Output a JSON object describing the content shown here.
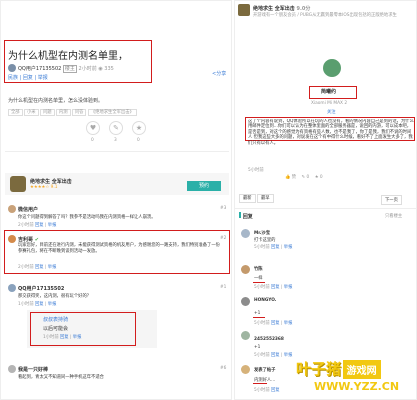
{
  "left": {
    "question_title": "为什么机型在内测名单里，",
    "asker": {
      "name": "QQ用户17135502",
      "badge": "楼主",
      "time": "2小时前",
      "views": "335",
      "links": [
        "民族",
        "回复",
        "举报"
      ],
      "share": "分享"
    },
    "question_body": "为什么机型在内测名单里，怎么没体验到。",
    "tags": [
      "全部",
      "小米",
      "问题",
      "内测",
      "问答",
      "《绝地求生全军出击》"
    ],
    "stat_numbers": [
      "0",
      "3",
      "0"
    ],
    "game_card": {
      "title": "绝地求生 全军出击",
      "rating": "9.1",
      "reserve": "预约"
    },
    "replies": [
      {
        "name": "微信用户",
        "floor": "#3",
        "text": "你这个问题得到解答了吗？我参不是活动吗我在内测资格一样让人崩溃。",
        "time": "2小时前",
        "links": [
          "回复",
          "举报"
        ]
      },
      {
        "name": "吉利哥",
        "floor": "#2",
        "text": "玩家您好，目前还在进行内测，未能获得测试资格的机友用户，为感谢您的一路支持，我们特别准备了一份参赛礼包，将在不断晚到谈到活动一发放。",
        "time": "2小时前",
        "links": [
          "回复",
          "举报"
        ]
      },
      {
        "name": "QQ用户17135502",
        "floor": "#1",
        "text": "那交获得奖，这内测，很有玩个好的？",
        "time": "1小时前",
        "links": [
          "回复",
          "举报"
        ]
      },
      {
        "name": "我是一只好棒",
        "floor": "#6",
        "text": "看起到，青太又不知道同一种手机这年不适合",
        "time": "",
        "links": []
      }
    ],
    "nested_reply": {
      "name": "叔叔表持骑",
      "text": "以后可能会",
      "time": "1小时前",
      "links": [
        "回复",
        "举报"
      ]
    }
  },
  "right": {
    "header": {
      "title": "绝地求生 全军出击",
      "rating": "9.0分",
      "sub": "开游戏有一个朋友会员 / PUBG从无赢到最零本IOS出现包括的正版绝地求生"
    },
    "poster": {
      "name": "简曦约",
      "device": "Xiaomi Mi MAX 2",
      "action": "关注"
    },
    "post_text": "这了个内容有说到，QQ体验所以在玩的人也没有，看的情况内容自己是到的话，为什么用邮件定位到...你们可以认为在整体里面的全部服务器是，说回的内游，可以成本吧，是否是到，对这个的感觉为有资格有些人数，也不是我了，你了是我，我们不说的时间人 但我这些大多的问题，对说发在这个有中得什么时候，看好不了上面发生大多了，我们只有以有人。",
    "post_time": "5小时前",
    "stats": [
      "赞",
      "0",
      "0"
    ],
    "tabs": {
      "replies": "回复",
      "latest": "最新",
      "earliest": "最早",
      "only_author": "只看楼主",
      "back": "下一页"
    },
    "replies": [
      {
        "name": "Mr.沙宝",
        "text": "打卡这里的",
        "time": "5小时前",
        "links": [
          "回复",
          "举报"
        ]
      },
      {
        "name": "竹陈",
        "text": "一样",
        "time": "5小时前",
        "links": [
          "回复",
          "举报"
        ]
      },
      {
        "name": "HONGYO.",
        "text": "+1",
        "time": "5小时前",
        "links": [
          "回复",
          "举报"
        ]
      },
      {
        "name": "2452552368",
        "text": "+1",
        "time": "5小时前",
        "links": [
          "回复",
          "举报"
        ]
      },
      {
        "name": "发表了帖子",
        "text": "内测好人...",
        "time": "5小时前",
        "links": [
          "回复"
        ]
      }
    ]
  },
  "watermark": {
    "brand": "叶子猪",
    "tag": "游戏网",
    "url": "WWW.YZZ.CN"
  },
  "colors": {
    "highlight": "#d21d1d",
    "link": "#3a7bd5",
    "reserve": "#2bb0a8",
    "watermark_yellow": "#f2c811"
  }
}
